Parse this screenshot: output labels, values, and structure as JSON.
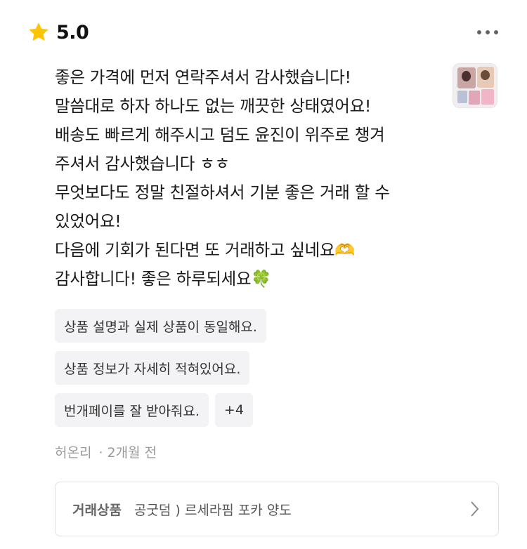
{
  "rating": {
    "value": "5.0"
  },
  "review": {
    "lines": [
      "좋은 가격에 먼저 연락주셔서 감사했습니다!",
      "말씀대로 하자 하나도 없는 깨끗한 상태였어요!",
      "배송도 빠르게 해주시고 덤도 윤진이 위주로 챙겨",
      "주셔서 감사했습니다 ㅎㅎ",
      "무엇보다도 정말 친절하셔서 기분 좋은 거래 할 수",
      "있었어요!",
      "다음에 기회가 된다면 또 거래하고 싶네요🫶",
      "감사합니다! 좋은 하루되세요🍀"
    ]
  },
  "tags": {
    "tag1": "상품 설명과 실제 상품이 동일해요.",
    "tag2": "상품 정보가 자세히 적혀있어요.",
    "tag3": "번개페이를 잘 받아줘요.",
    "more": "+4"
  },
  "meta": {
    "author": "허온리",
    "time": "· 2개월 전"
  },
  "product": {
    "label": "거래상품",
    "name": "공굿덤 ) 르세라핌 포카 양도"
  },
  "colors": {
    "star": "#FFC400",
    "text": "#1a1a1a",
    "tag_bg": "#f3f3f5",
    "meta": "#9a9a9a"
  },
  "icons": {
    "star": "star-icon",
    "more": "more-dots-icon",
    "chevron": "chevron-right-icon"
  }
}
